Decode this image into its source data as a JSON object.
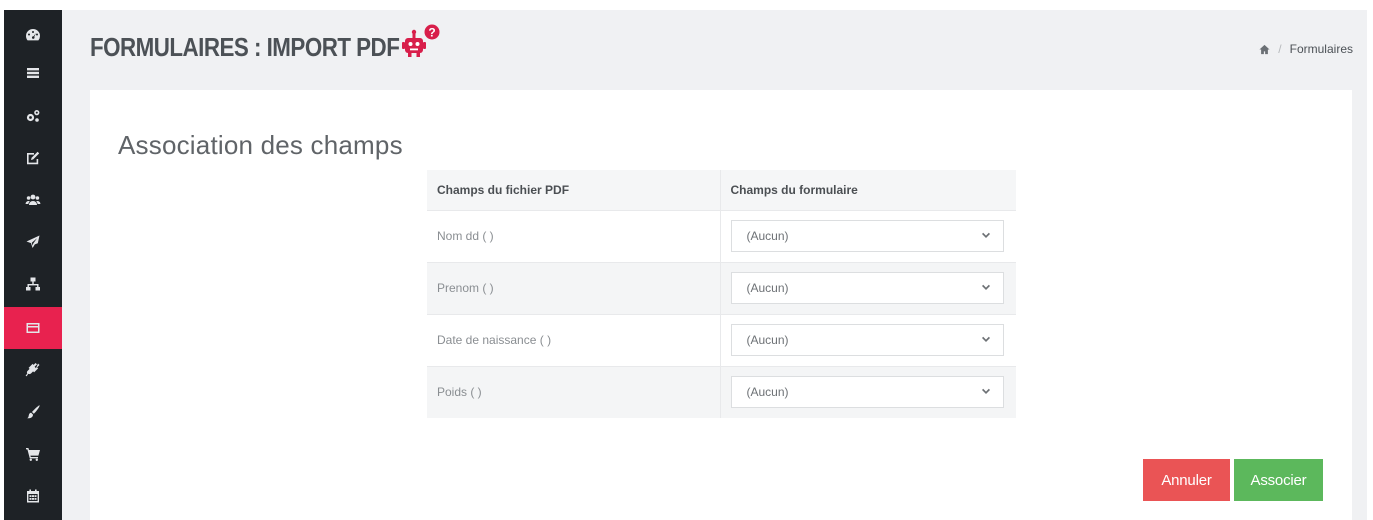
{
  "sidebar": {
    "items": [
      {
        "icon": "dashboard-icon"
      },
      {
        "icon": "list-icon"
      },
      {
        "icon": "gears-icon"
      },
      {
        "icon": "edit-icon"
      },
      {
        "icon": "users-icon"
      },
      {
        "icon": "send-icon"
      },
      {
        "icon": "sitemap-icon"
      },
      {
        "icon": "form-icon",
        "active": true
      },
      {
        "icon": "plug-icon"
      },
      {
        "icon": "brush-icon"
      },
      {
        "icon": "cart-icon"
      },
      {
        "icon": "calendar-icon"
      }
    ],
    "active_color": "#e8224f"
  },
  "header": {
    "title": "FORMULAIRES : IMPORT PDF",
    "help_icon": "robot-help-icon"
  },
  "breadcrumb": {
    "home_icon": "home-icon",
    "separator": "/",
    "current": "Formulaires"
  },
  "panel": {
    "section_title": "Association des champs",
    "table": {
      "headers": [
        "Champs du fichier PDF",
        "Champs du formulaire"
      ],
      "rows": [
        {
          "field": "Nom dd ( )",
          "value": "(Aucun)"
        },
        {
          "field": "Prenom ( )",
          "value": "(Aucun)"
        },
        {
          "field": "Date de naissance ( )",
          "value": "(Aucun)"
        },
        {
          "field": "Poids ( )",
          "value": "(Aucun)"
        }
      ]
    },
    "buttons": {
      "cancel": "Annuler",
      "submit": "Associer"
    }
  },
  "colors": {
    "cancel": "#ea5455",
    "submit": "#5cb85c"
  }
}
